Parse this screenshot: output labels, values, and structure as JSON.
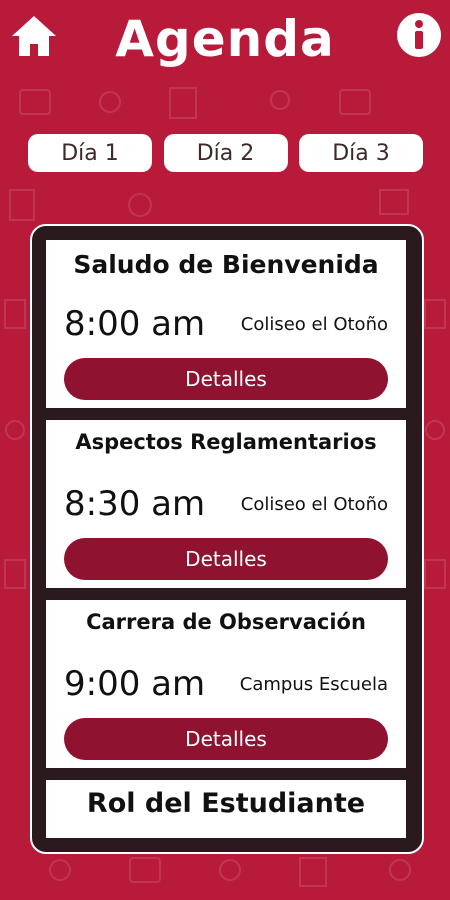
{
  "header": {
    "title": "Agenda",
    "home_icon": "home-icon",
    "info_icon": "info-icon"
  },
  "days": [
    {
      "label": "Día 1"
    },
    {
      "label": "Día 2"
    },
    {
      "label": "Día 3"
    }
  ],
  "agenda": {
    "items": [
      {
        "title": "Saludo de Bienvenida",
        "time": "8:00 am",
        "place": "Coliseo el Otoño",
        "button": "Detalles"
      },
      {
        "title": "Aspectos Reglamentarios",
        "time": "8:30 am",
        "place": "Coliseo el Otoño",
        "button": "Detalles"
      },
      {
        "title": "Carrera de Observación",
        "time": "9:00 am",
        "place": "Campus Escuela",
        "button": "Detalles"
      },
      {
        "title": "Rol del Estudiante"
      }
    ]
  },
  "colors": {
    "background": "#b81a3a",
    "panel": "#2a1a1e",
    "button": "#8f1230",
    "card": "#ffffff"
  }
}
